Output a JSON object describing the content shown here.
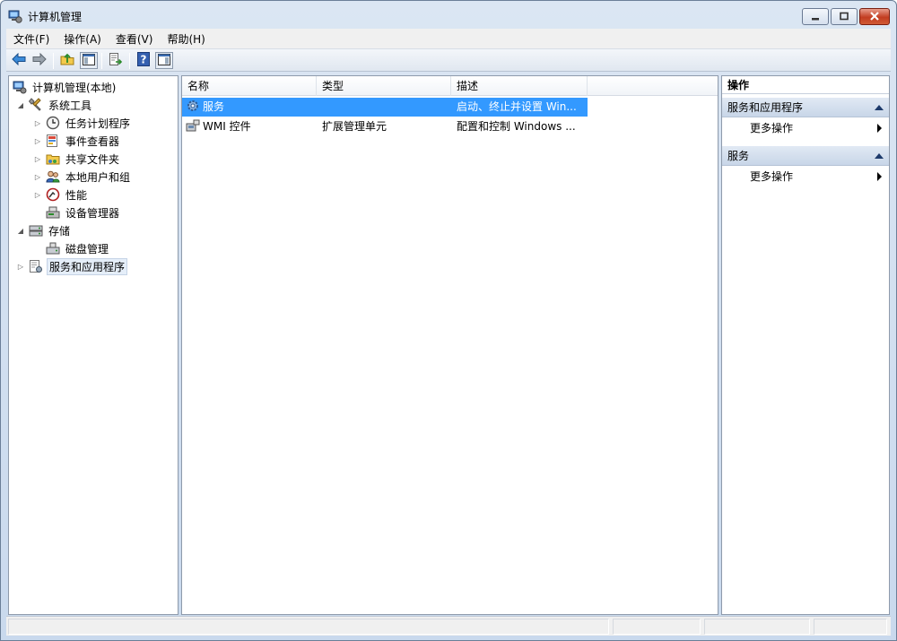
{
  "window": {
    "title": "计算机管理",
    "icons": {
      "app": "computer-management-icon",
      "minimize": "minimize-icon",
      "maximize": "maximize-icon",
      "close": "close-icon"
    }
  },
  "menubar": {
    "items": [
      {
        "label": "文件(F)"
      },
      {
        "label": "操作(A)"
      },
      {
        "label": "查看(V)"
      },
      {
        "label": "帮助(H)"
      }
    ]
  },
  "toolbar": {
    "buttons": [
      "back-arrow-icon",
      "forward-arrow-icon",
      "up-folder-icon",
      "show-hide-console-tree-icon",
      "export-list-icon",
      "help-icon",
      "show-hide-action-pane-icon"
    ]
  },
  "tree": {
    "root": {
      "label": "计算机管理(本地)"
    },
    "system_tools": {
      "label": "系统工具"
    },
    "task_scheduler": {
      "label": "任务计划程序"
    },
    "event_viewer": {
      "label": "事件查看器"
    },
    "shared_folders": {
      "label": "共享文件夹"
    },
    "local_users": {
      "label": "本地用户和组"
    },
    "performance": {
      "label": "性能"
    },
    "device_manager": {
      "label": "设备管理器"
    },
    "storage": {
      "label": "存储"
    },
    "disk_management": {
      "label": "磁盘管理"
    },
    "services_apps": {
      "label": "服务和应用程序"
    }
  },
  "list": {
    "columns": [
      {
        "label": "名称"
      },
      {
        "label": "类型"
      },
      {
        "label": "描述"
      }
    ],
    "rows": [
      {
        "name": "服务",
        "type": "",
        "description": "启动、终止并设置 Win..."
      },
      {
        "name": "WMI 控件",
        "type": "扩展管理单元",
        "description": "配置和控制 Windows ..."
      }
    ]
  },
  "actions": {
    "header": "操作",
    "sections": [
      {
        "title": "服务和应用程序",
        "item": "更多操作"
      },
      {
        "title": "服务",
        "item": "更多操作"
      }
    ]
  },
  "colors": {
    "selection": "#3399ff",
    "tree_selection": "#e5eef9",
    "section_header": "#c8d6e8"
  }
}
